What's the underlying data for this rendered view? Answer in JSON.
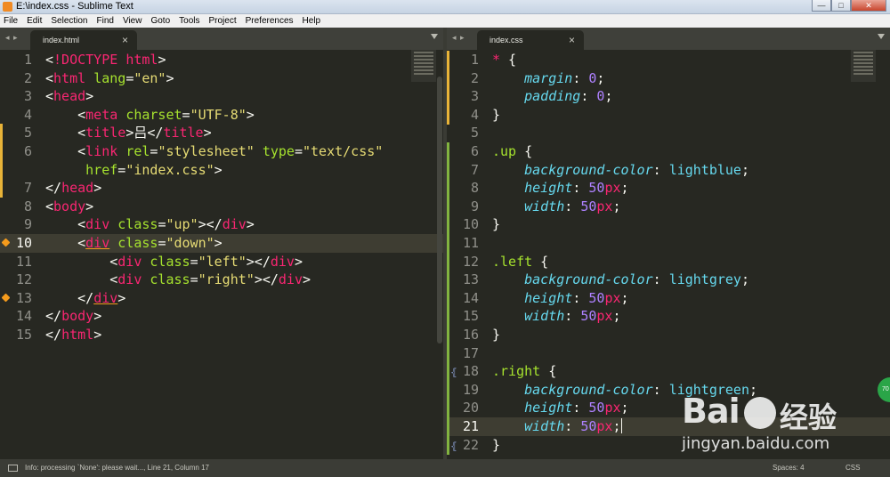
{
  "window": {
    "title": "E:\\index.css - Sublime Text",
    "buttons": {
      "minimize": "—",
      "maximize": "□",
      "close": "✕"
    }
  },
  "menu": [
    "File",
    "Edit",
    "Selection",
    "Find",
    "View",
    "Goto",
    "Tools",
    "Project",
    "Preferences",
    "Help"
  ],
  "left_pane": {
    "nav_arrows": "◂ ▸",
    "tab_label": "index.html",
    "tab_close": "×",
    "line_numbers": [
      "1",
      "2",
      "3",
      "4",
      "5",
      "6",
      "",
      "7",
      "8",
      "9",
      "10",
      "11",
      "12",
      "13",
      "14",
      "15"
    ],
    "highlighted_line": "10"
  },
  "right_pane": {
    "nav_arrows": "◂ ▸",
    "tab_label": "index.css",
    "tab_close": "×",
    "line_numbers": [
      "1",
      "2",
      "3",
      "4",
      "5",
      "6",
      "7",
      "8",
      "9",
      "10",
      "11",
      "12",
      "13",
      "14",
      "15",
      "16",
      "17",
      "18",
      "19",
      "20",
      "21",
      "22"
    ],
    "highlighted_line": "21"
  },
  "status": {
    "info": "Info: processing `None': please wait..., Line 21, Column 17",
    "spaces": "Spaces: 4",
    "syntax": "CSS"
  },
  "watermark": {
    "logo_prefix": "Bai",
    "logo_cn": "经验",
    "url": "jingyan.baidu.com",
    "side_badge": "70"
  },
  "colors": {
    "background": "#272822",
    "tag": "#f92672",
    "attribute": "#a6e22e",
    "string": "#e6db74",
    "property": "#66d9ef",
    "number": "#ae81ff",
    "modified_marker": "#e8b338",
    "added_marker": "#82b340"
  },
  "html_code": [
    [
      "<",
      "!DOCTYPE",
      " ",
      "html",
      ">"
    ],
    [
      "<",
      "html",
      " ",
      "lang",
      "=",
      "\"en\"",
      ">"
    ],
    [
      "<",
      "head",
      ">"
    ],
    [
      "    <",
      "meta",
      " ",
      "charset",
      "=",
      "\"UTF-8\"",
      ">"
    ],
    [
      "    <",
      "title",
      ">",
      "吕",
      "</",
      "title",
      ">"
    ],
    [
      "    <",
      "link",
      " ",
      "rel",
      "=",
      "\"stylesheet\"",
      " ",
      "type",
      "=",
      "\"text/css\""
    ],
    [
      "     ",
      "href",
      "=",
      "\"index.css\"",
      ">"
    ],
    [
      "</",
      "head",
      ">"
    ],
    [
      "<",
      "body",
      ">"
    ],
    [
      "    <",
      "div",
      " ",
      "class",
      "=",
      "\"up\"",
      "></",
      "div",
      ">"
    ],
    [
      "    <",
      "div",
      " ",
      "class",
      "=",
      "\"down\"",
      ">"
    ],
    [
      "        <",
      "div",
      " ",
      "class",
      "=",
      "\"left\"",
      "></",
      "div",
      ">"
    ],
    [
      "        <",
      "div",
      " ",
      "class",
      "=",
      "\"right\"",
      "></",
      "div",
      ">"
    ],
    [
      "    </",
      "div",
      ">"
    ],
    [
      "</",
      "body",
      ">"
    ],
    [
      "</",
      "html",
      ">"
    ]
  ],
  "css_code": [
    [
      "*",
      " {"
    ],
    [
      "    ",
      "margin",
      ": ",
      "0",
      ";"
    ],
    [
      "    ",
      "padding",
      ": ",
      "0",
      ";"
    ],
    [
      "}"
    ],
    [
      ""
    ],
    [
      ".up",
      " {"
    ],
    [
      "    ",
      "background-color",
      ": ",
      "lightblue",
      ";"
    ],
    [
      "    ",
      "height",
      ": ",
      "50",
      "px",
      ";"
    ],
    [
      "    ",
      "width",
      ": ",
      "50",
      "px",
      ";"
    ],
    [
      "}"
    ],
    [
      ""
    ],
    [
      ".left",
      " {"
    ],
    [
      "    ",
      "background-color",
      ": ",
      "lightgrey",
      ";"
    ],
    [
      "    ",
      "height",
      ": ",
      "50",
      "px",
      ";"
    ],
    [
      "    ",
      "width",
      ": ",
      "50",
      "px",
      ";"
    ],
    [
      "}"
    ],
    [
      ""
    ],
    [
      ".right",
      " {"
    ],
    [
      "    ",
      "background-color",
      ": ",
      "lightgreen",
      ";"
    ],
    [
      "    ",
      "height",
      ": ",
      "50",
      "px",
      ";"
    ],
    [
      "    ",
      "width",
      ": ",
      "50",
      "px",
      ";"
    ],
    [
      "}"
    ]
  ]
}
